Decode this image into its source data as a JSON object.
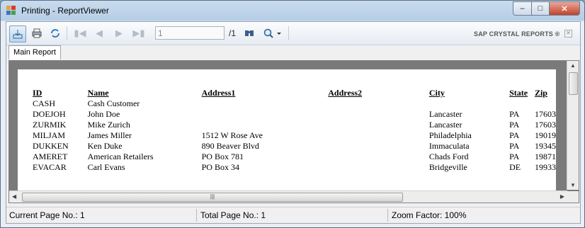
{
  "window": {
    "title": "Printing - ReportViewer"
  },
  "toolbar": {
    "current_page_value": "1",
    "total_pages": "/1",
    "brand": "SAP CRYSTAL REPORTS ®"
  },
  "tabs": [
    {
      "label": "Main Report"
    }
  ],
  "report": {
    "headers": [
      "ID",
      "Name",
      "Address1",
      "Address2",
      "City",
      "State",
      "Zip"
    ],
    "rows": [
      [
        "CASH",
        "Cash Customer",
        "",
        "",
        "",
        "",
        ""
      ],
      [
        "DOEJOH",
        "John Doe",
        "",
        "",
        "Lancaster",
        "PA",
        "17603"
      ],
      [
        "ZURMIK",
        "Mike Zurich",
        "",
        "",
        "Lancaster",
        "PA",
        "17603"
      ],
      [
        "MILJAM",
        "James Miller",
        "1512 W Rose Ave",
        "",
        "Philadelphia",
        "PA",
        "19019"
      ],
      [
        "DUKKEN",
        "Ken Duke",
        "890 Beaver Blvd",
        "",
        "Immaculata",
        "PA",
        "19345"
      ],
      [
        "AMERET",
        "American Retailers",
        "PO Box 781",
        "",
        "Chads Ford",
        "PA",
        "19871"
      ],
      [
        "EVACAR",
        "Carl Evans",
        "PO Box 34",
        "",
        "Bridgeville",
        "DE",
        "19933"
      ]
    ]
  },
  "statusbar": {
    "current_page": "Current Page No.: 1",
    "total_page": "Total Page No.: 1",
    "zoom": "Zoom Factor: 100%"
  },
  "icons": [
    "export-icon",
    "print-icon",
    "refresh-icon",
    "first-page-icon",
    "prev-page-icon",
    "next-page-icon",
    "last-page-icon",
    "find-icon",
    "zoom-icon",
    "close-icon"
  ]
}
